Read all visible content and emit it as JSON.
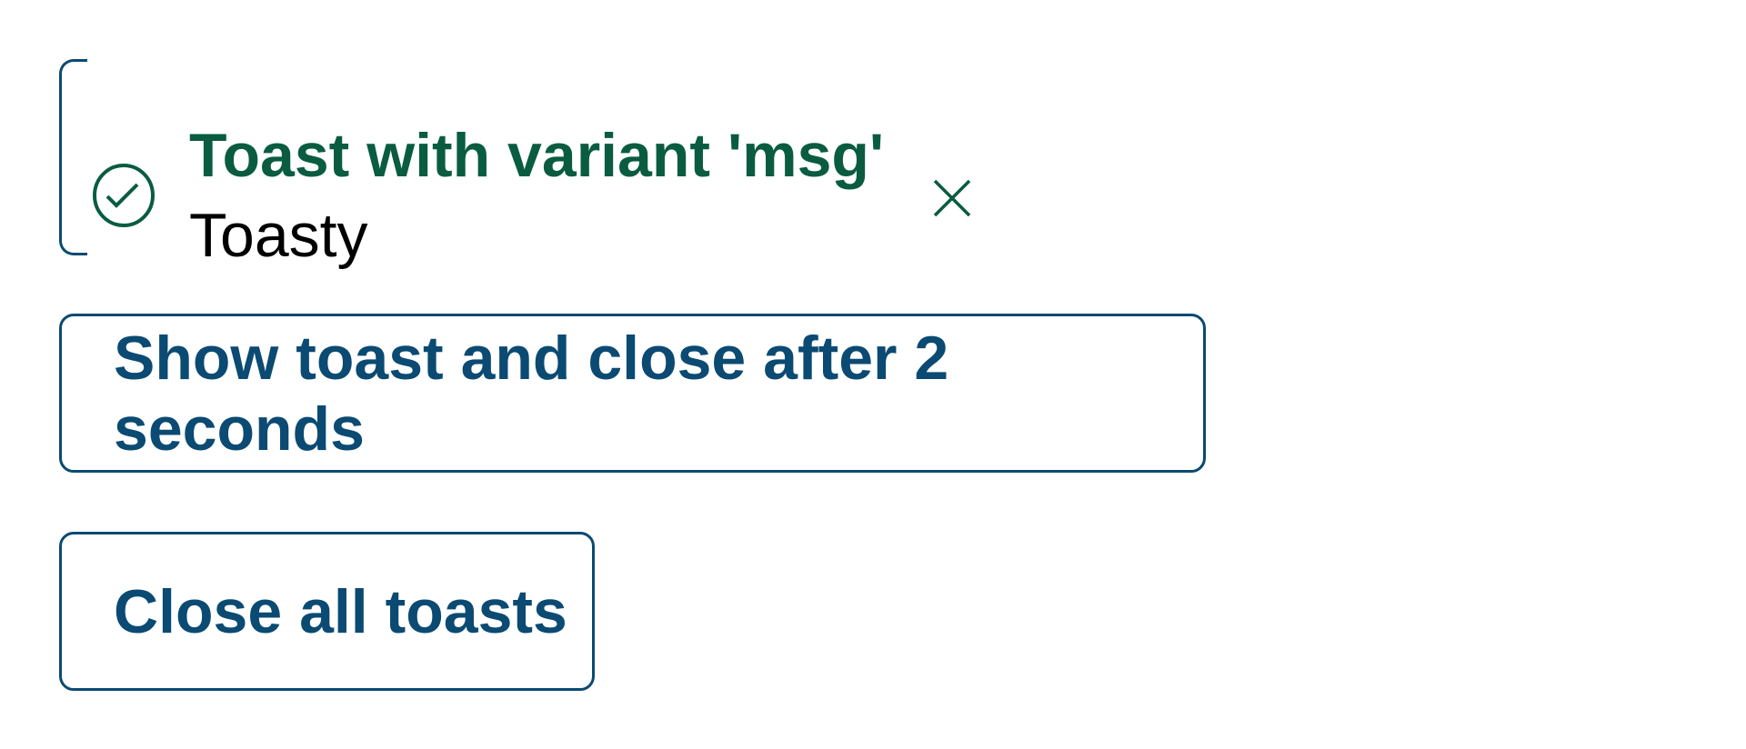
{
  "toast": {
    "variant": "msg",
    "title": "Toast with variant 'msg'",
    "body": "Toasty",
    "icon": "check-circle-icon",
    "close_icon": "close-icon",
    "accent_color": "#0a5c40"
  },
  "buttons": {
    "show_timed": "Show toast and close after 2 seconds",
    "close_all": "Close all toasts"
  },
  "colors": {
    "primary": "#0b4a72"
  }
}
